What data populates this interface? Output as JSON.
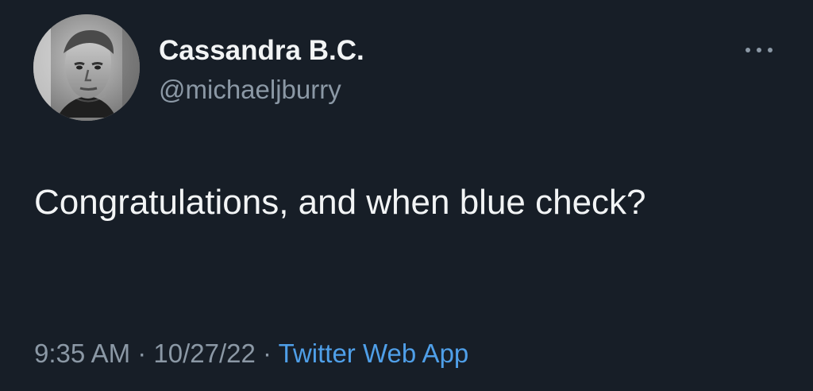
{
  "tweet": {
    "author": {
      "display_name": "Cassandra B.C.",
      "handle": "@michaeljburry",
      "avatar_icon": "profile-photo"
    },
    "more_icon": "more-options-icon",
    "text": "Congratulations, and when blue check?",
    "meta": {
      "time": "9:35 AM",
      "separator_1": " · ",
      "date": "10/27/22",
      "separator_2": " · ",
      "source": "Twitter Web App"
    }
  },
  "colors": {
    "background": "#171e27",
    "text": "#f2f4f5",
    "secondary_text": "#8b98a5",
    "link": "#4f9fe8"
  }
}
